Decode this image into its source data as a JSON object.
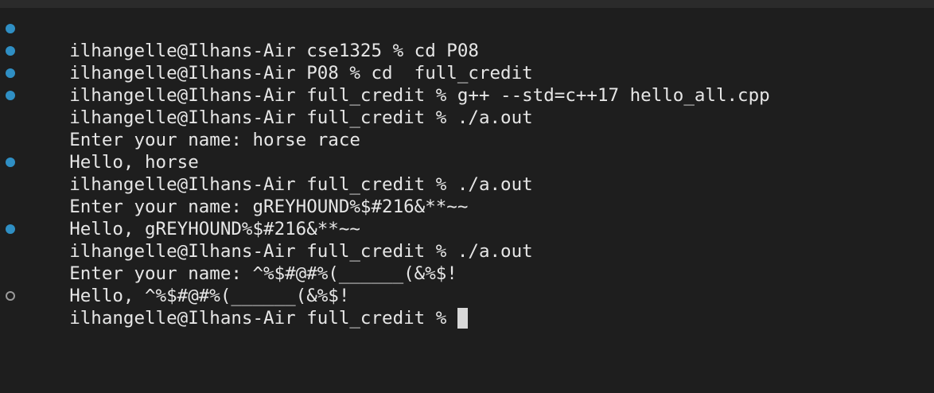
{
  "colors": {
    "background": "#1e1e1e",
    "text": "#e6e6e6",
    "success_marker": "#2f8fc4",
    "pending_marker": "#9a9a9a"
  },
  "terminal": {
    "lines": [
      {
        "marker": "done",
        "prompt": "ilhangelle@Ilhans-Air cse1325 % ",
        "command": "cd P08"
      },
      {
        "marker": "done",
        "prompt": "ilhangelle@Ilhans-Air P08 % ",
        "command": "cd  full_credit"
      },
      {
        "marker": "done",
        "prompt": "ilhangelle@Ilhans-Air full_credit % ",
        "command": "g++ --std=c++17 hello_all.cpp"
      },
      {
        "marker": "done",
        "prompt": "ilhangelle@Ilhans-Air full_credit % ",
        "command": "./a.out"
      },
      {
        "marker": "none",
        "text": "Enter your name: horse race"
      },
      {
        "marker": "none",
        "text": "Hello, horse"
      },
      {
        "marker": "done",
        "prompt": "ilhangelle@Ilhans-Air full_credit % ",
        "command": "./a.out"
      },
      {
        "marker": "none",
        "text": "Enter your name: gREYHOUND%$#216&**~~"
      },
      {
        "marker": "none",
        "text": "Hello, gREYHOUND%$#216&**~~"
      },
      {
        "marker": "done",
        "prompt": "ilhangelle@Ilhans-Air full_credit % ",
        "command": "./a.out"
      },
      {
        "marker": "none",
        "text": "Enter your name: ^%$#@#%(______(&%$!"
      },
      {
        "marker": "none",
        "text": "Hello, ^%$#@#%(______(&%$!"
      },
      {
        "marker": "pending",
        "prompt": "ilhangelle@Ilhans-Air full_credit % ",
        "command": ""
      }
    ]
  }
}
